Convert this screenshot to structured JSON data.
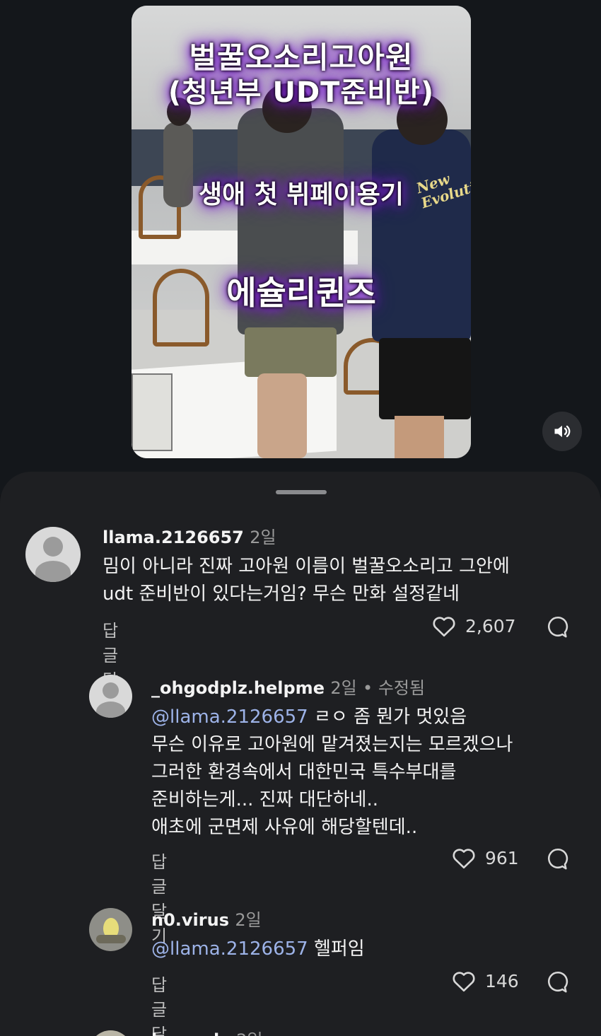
{
  "video": {
    "caption_line1": "벌꿀오소리고아원",
    "caption_line2": "(청년부 UDT준비반)",
    "caption_line3": "생애 첫 뷔페이용기",
    "caption_line4": "에슐리퀸즈",
    "shirt_text": "New Evolution",
    "sound_icon": "speaker-icon"
  },
  "comments": [
    {
      "username": "llama.2126657",
      "time": "2일",
      "lines": [
        "밈이 아니라 진짜 고아원 이름이 벌꿀오소리고 그안에",
        "udt 준비반이 있다는거임? 무슨 만화 설정같네"
      ],
      "reply_label": "답글 달기",
      "likes": "2,607"
    },
    {
      "username": "_ohgodplz.helpme",
      "time": "2일",
      "edited": "• 수정됨",
      "mention": "@llama.2126657",
      "first_line_rest": "ㄹㅇ 좀 뭔가 멋있음",
      "lines": [
        "무슨 이유로 고아원에 맡겨졌는지는 모르겠으나",
        "그러한 환경속에서 대한민국 특수부대를",
        "준비하는게... 진짜 대단하네..",
        "애초에 군면제 사유에 해당할텐데.."
      ],
      "reply_label": "답글 달기",
      "likes": "961"
    },
    {
      "username": "n0.virus",
      "time": "2일",
      "mention": "@llama.2126657",
      "first_line_rest": "헬퍼임",
      "reply_label": "답글 달기",
      "likes": "146"
    },
    {
      "username": "lonnu_lv",
      "time": "2일"
    }
  ]
}
